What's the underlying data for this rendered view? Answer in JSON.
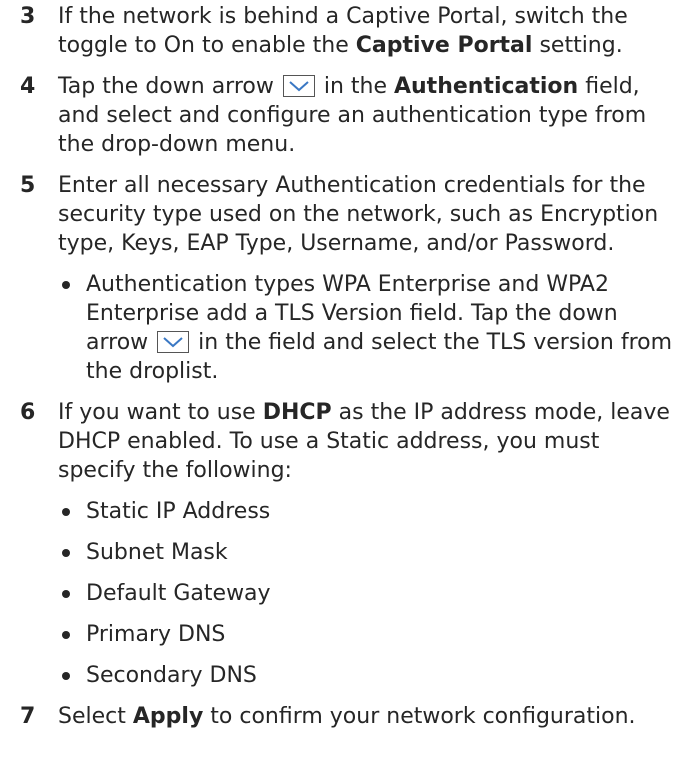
{
  "steps": [
    {
      "num": "3",
      "t1": "If the network is behind a Captive Portal, switch the toggle to On to enable the ",
      "b1": "Captive Portal",
      "t2": " setting."
    },
    {
      "num": "4",
      "t1": "Tap the down arrow ",
      "t2": " in the ",
      "b1": "Authentication",
      "t3": " field, and select and configure an authentication type from the drop-down menu."
    },
    {
      "num": "5",
      "t1": "Enter all necessary Authentication credentials for the security type used on the network, such as Encryption type, Keys, EAP Type, Username, and/or Password.",
      "bullet_t1": "Authentication types WPA Enterprise and WPA2 Enterprise add a TLS Version field. Tap the down arrow ",
      "bullet_t2": " in the field and select the TLS version from the droplist."
    },
    {
      "num": "6",
      "t1": "If you want to use ",
      "b1": "DHCP",
      "t2": " as the IP address mode, leave DHCP enabled. To use a Static address, you must specify the following:",
      "bullets": [
        "Static IP Address",
        "Subnet Mask",
        "Default Gateway",
        "Primary DNS",
        "Secondary DNS"
      ]
    },
    {
      "num": "7",
      "t1": "Select ",
      "b1": "Apply",
      "t2": " to confirm your network configuration."
    }
  ],
  "icons": {
    "down_arrow": "chevron-down-icon"
  }
}
